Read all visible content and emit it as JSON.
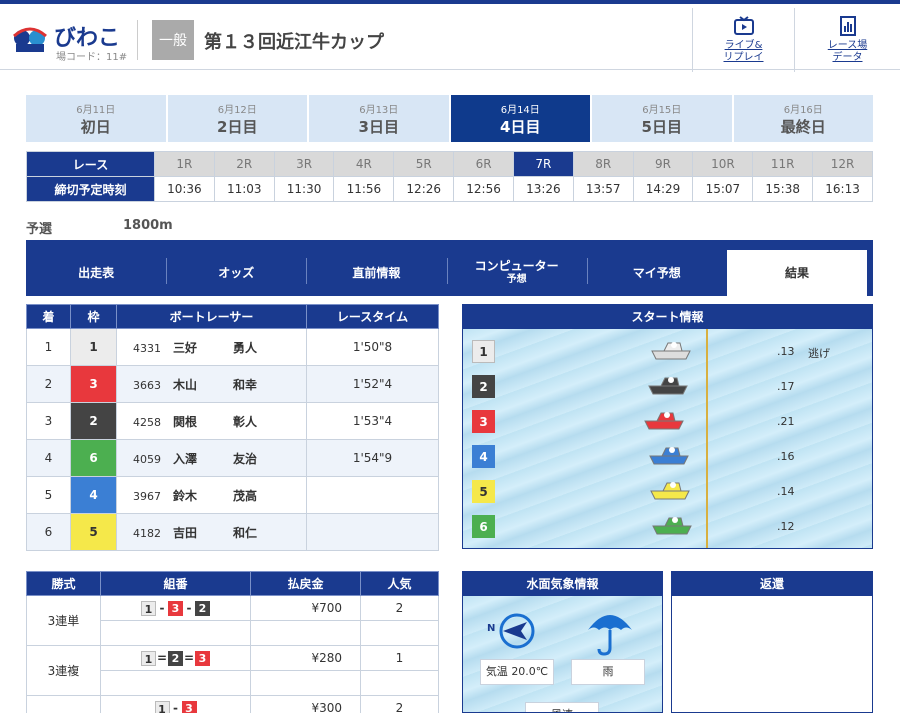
{
  "header": {
    "venue": "びわこ",
    "venue_code": "場コード：11#",
    "grade": "一般",
    "race_title": "第１３回近江牛カップ",
    "live_label": "ライブ&\nリプレイ",
    "data_label": "レース場\nデータ"
  },
  "days": [
    {
      "date": "6月11日",
      "label": "初日",
      "active": false
    },
    {
      "date": "6月12日",
      "label": "2日目",
      "active": false
    },
    {
      "date": "6月13日",
      "label": "3日目",
      "active": false
    },
    {
      "date": "6月14日",
      "label": "4日目",
      "active": true
    },
    {
      "date": "6月15日",
      "label": "5日目",
      "active": false
    },
    {
      "date": "6月16日",
      "label": "最終日",
      "active": false
    }
  ],
  "races": {
    "row1_label": "レース",
    "row2_label": "締切予定時刻",
    "numbers": [
      "1R",
      "2R",
      "3R",
      "4R",
      "5R",
      "6R",
      "7R",
      "8R",
      "9R",
      "10R",
      "11R",
      "12R"
    ],
    "times": [
      "10:36",
      "11:03",
      "11:30",
      "11:56",
      "12:26",
      "12:56",
      "13:26",
      "13:57",
      "14:29",
      "15:07",
      "15:38",
      "16:13"
    ],
    "active_index": 6
  },
  "race_info": {
    "type": "予選",
    "distance": "1800m"
  },
  "tabs": [
    {
      "label": "出走表",
      "sub": ""
    },
    {
      "label": "オッズ",
      "sub": ""
    },
    {
      "label": "直前情報",
      "sub": ""
    },
    {
      "label": "コンピューター",
      "sub": "予想"
    },
    {
      "label": "マイ予想",
      "sub": ""
    },
    {
      "label": "結果",
      "sub": "",
      "active": true
    }
  ],
  "results": {
    "headers": [
      "着",
      "枠",
      "ボートレーサー",
      "レースタイム"
    ],
    "rows": [
      {
        "place": "1",
        "waku": "1",
        "reg": "4331",
        "last": "三好",
        "first": "勇人",
        "time": "1'50\"8"
      },
      {
        "place": "2",
        "waku": "3",
        "reg": "3663",
        "last": "木山",
        "first": "和幸",
        "time": "1'52\"4"
      },
      {
        "place": "3",
        "waku": "2",
        "reg": "4258",
        "last": "関根",
        "first": "彰人",
        "time": "1'53\"4"
      },
      {
        "place": "4",
        "waku": "6",
        "reg": "4059",
        "last": "入澤",
        "first": "友治",
        "time": "1'54\"9"
      },
      {
        "place": "5",
        "waku": "4",
        "reg": "3967",
        "last": "鈴木",
        "first": "茂高",
        "time": ""
      },
      {
        "place": "6",
        "waku": "5",
        "reg": "4182",
        "last": "吉田",
        "first": "和仁",
        "time": ""
      }
    ]
  },
  "waku_colors": {
    "1": {
      "bg": "#ececec",
      "fg": "#333333"
    },
    "2": {
      "bg": "#444444",
      "fg": "#ffffff"
    },
    "3": {
      "bg": "#e8383d",
      "fg": "#ffffff"
    },
    "4": {
      "bg": "#3b7fd4",
      "fg": "#ffffff"
    },
    "5": {
      "bg": "#f5e84a",
      "fg": "#333333"
    },
    "6": {
      "bg": "#4caf50",
      "fg": "#ffffff"
    }
  },
  "start_info": {
    "title": "スタート情報",
    "rows": [
      {
        "boat": "1",
        "st": ".13",
        "note": "逃げ"
      },
      {
        "boat": "2",
        "st": ".17",
        "note": ""
      },
      {
        "boat": "3",
        "st": ".21",
        "note": ""
      },
      {
        "boat": "4",
        "st": ".16",
        "note": ""
      },
      {
        "boat": "5",
        "st": ".14",
        "note": ""
      },
      {
        "boat": "6",
        "st": ".12",
        "note": ""
      }
    ]
  },
  "payout": {
    "headers": [
      "勝式",
      "組番",
      "払戻金",
      "人気"
    ],
    "rows": [
      {
        "type": "3連単",
        "combo": [
          "1",
          "3",
          "2"
        ],
        "sep": "-",
        "amount": "¥700",
        "pop": "2"
      },
      {
        "type": "3連複",
        "combo": [
          "1",
          "2",
          "3"
        ],
        "sep": "=",
        "amount": "¥280",
        "pop": "1"
      },
      {
        "type": "2連単",
        "combo": [
          "1",
          "3"
        ],
        "sep": "-",
        "amount": "¥300",
        "pop": "2"
      }
    ]
  },
  "weather": {
    "title": "水面気象情報",
    "wind_dir_label": "N",
    "temp_label": "気温",
    "temp": "20.0℃",
    "weather": "雨",
    "wind_label": "風速"
  },
  "henkan": {
    "title": "返還"
  }
}
